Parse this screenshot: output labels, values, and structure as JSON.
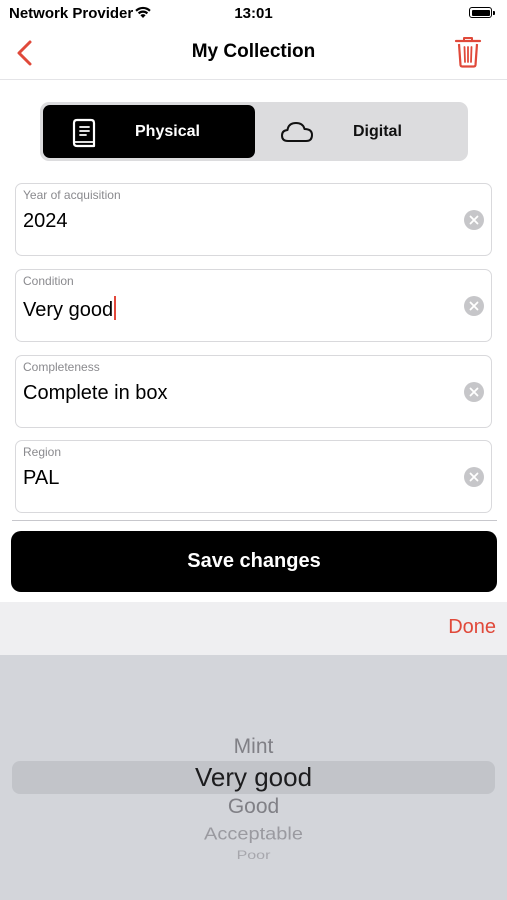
{
  "status_bar": {
    "carrier": "Network Provider",
    "time": "13:01"
  },
  "nav": {
    "title": "My Collection",
    "back_icon": "chevron-left-icon",
    "delete_icon": "trash-icon",
    "accent_color": "#e0493a"
  },
  "segments": [
    {
      "label": "Physical",
      "icon": "book-icon",
      "selected": true
    },
    {
      "label": "Digital",
      "icon": "cloud-icon",
      "selected": false
    }
  ],
  "fields": [
    {
      "label": "Year of acquisition",
      "value": "2024"
    },
    {
      "label": "Condition",
      "value": "Very good",
      "focused": true
    },
    {
      "label": "Completeness",
      "value": "Complete in box"
    },
    {
      "label": "Region",
      "value": "PAL"
    }
  ],
  "save_label": "Save changes",
  "keyboard": {
    "done_label": "Done"
  },
  "picker": {
    "options": [
      "Mint",
      "Very good",
      "Good",
      "Acceptable",
      "Poor"
    ],
    "selected": "Very good"
  }
}
